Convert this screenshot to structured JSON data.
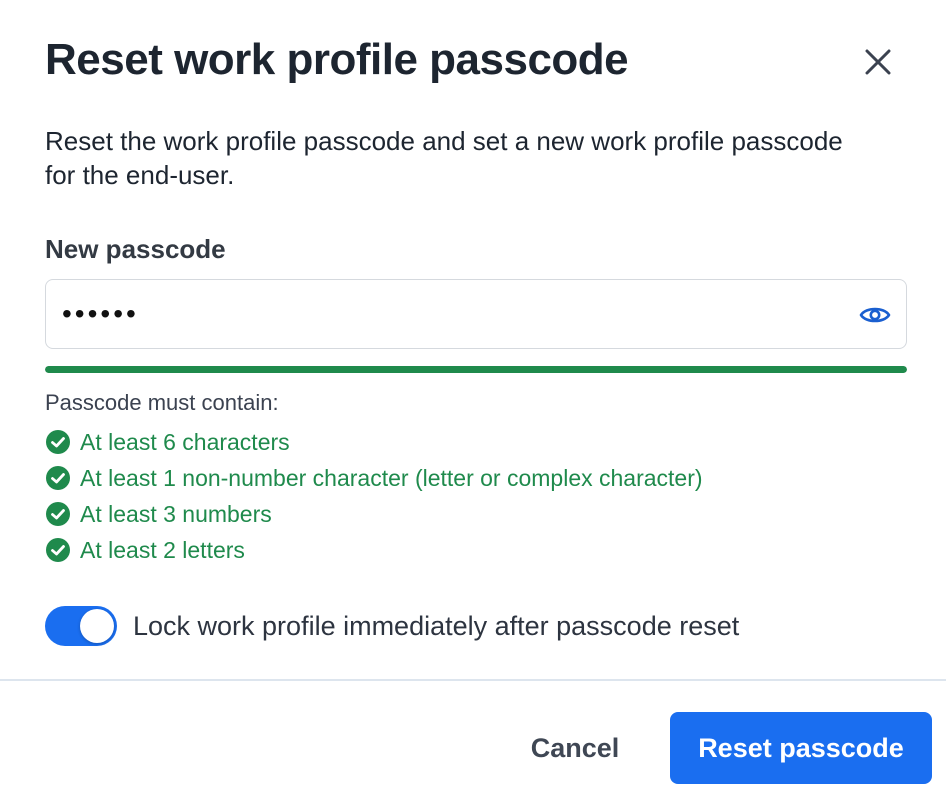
{
  "dialog": {
    "title": "Reset work profile passcode",
    "description": "Reset the work profile passcode and set a new work profile passcode for the end-user.",
    "close_icon": "close-icon"
  },
  "passcode": {
    "label": "New passcode",
    "value": "••••••",
    "reveal_icon": "eye-icon",
    "strength_fraction": 1.0,
    "strength_color": "#1f8a4c"
  },
  "requirements": {
    "heading": "Passcode must contain:",
    "items": [
      {
        "label": "At least 6 characters",
        "met": true
      },
      {
        "label": "At least 1 non-number character (letter or complex character)",
        "met": true
      },
      {
        "label": "At least 3 numbers",
        "met": true
      },
      {
        "label": "At least 2 letters",
        "met": true
      }
    ],
    "met_color": "#1f8a4c",
    "check_icon": "check-circle-icon"
  },
  "lock_toggle": {
    "label": "Lock work profile immediately after passcode reset",
    "on": true,
    "on_color": "#1a6ef0"
  },
  "footer": {
    "cancel_label": "Cancel",
    "submit_label": "Reset passcode",
    "accent": "#1a6ef0"
  }
}
